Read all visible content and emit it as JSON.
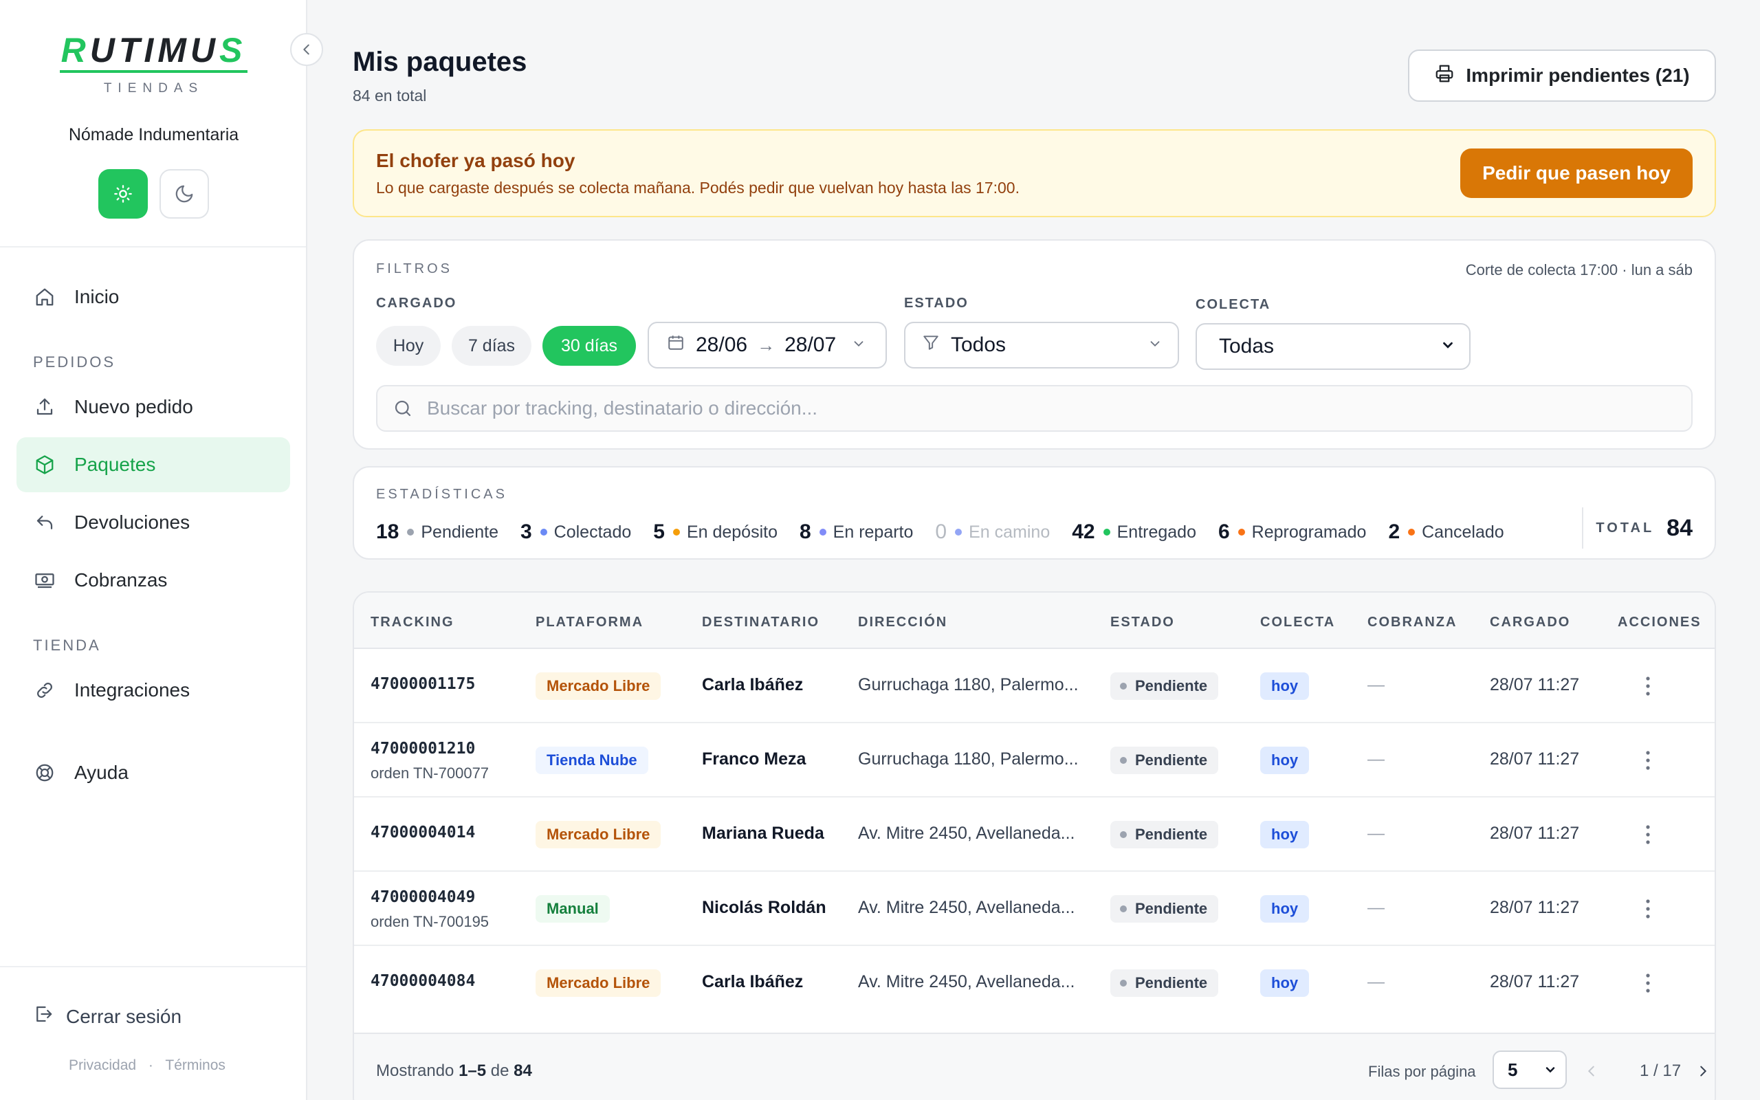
{
  "sidebar": {
    "logo_main_a": "R",
    "logo_main_b": "UTIMU",
    "logo_main_c": "S",
    "logo_sub": "TIENDAS",
    "store_name": "Nómade Indumentaria",
    "nav": {
      "inicio": "Inicio",
      "section_pedidos": "PEDIDOS",
      "nuevo_pedido": "Nuevo pedido",
      "paquetes": "Paquetes",
      "devoluciones": "Devoluciones",
      "cobranzas": "Cobranzas",
      "section_tienda": "TIENDA",
      "integraciones": "Integraciones",
      "ayuda": "Ayuda"
    },
    "logout": "Cerrar sesión",
    "privacy": "Privacidad",
    "legal_sep": "·",
    "terms": "Términos"
  },
  "header": {
    "title": "Mis paquetes",
    "subtitle": "84 en total",
    "print_label": "Imprimir pendientes (21)"
  },
  "banner": {
    "title": "El chofer ya pasó hoy",
    "text": "Lo que cargaste después se colecta mañana. Podés pedir que vuelvan hoy hasta las 17:00.",
    "button": "Pedir que pasen hoy"
  },
  "filters": {
    "heading": "FILTROS",
    "corte": "Corte de colecta 17:00 · lun a sáb",
    "cargado_label": "CARGADO",
    "chips": [
      "Hoy",
      "7 días",
      "30 días"
    ],
    "active_chip": "30 días",
    "date_from": "28/06",
    "date_arrow": "→",
    "date_to": "28/07",
    "estado_label": "ESTADO",
    "estado_value": "Todos",
    "colecta_label": "COLECTA",
    "colecta_value": "Todas",
    "search_placeholder": "Buscar por tracking, destinatario o dirección..."
  },
  "stats": {
    "heading": "ESTADÍSTICAS",
    "items": [
      {
        "num": "18",
        "label": "Pendiente",
        "color": "#9ca3af"
      },
      {
        "num": "3",
        "label": "Colectado",
        "color": "#6b8af5"
      },
      {
        "num": "5",
        "label": "En depósito",
        "color": "#f59e0b"
      },
      {
        "num": "8",
        "label": "En reparto",
        "color": "#818cf8"
      },
      {
        "num": "0",
        "label": "En camino",
        "color": "#93a5f5"
      },
      {
        "num": "42",
        "label": "Entregado",
        "color": "#22c55e"
      },
      {
        "num": "6",
        "label": "Reprogramado",
        "color": "#f97316"
      },
      {
        "num": "2",
        "label": "Cancelado",
        "color": "#f97316"
      }
    ],
    "total_label": "TOTAL",
    "total_value": "84"
  },
  "table": {
    "headers": [
      "TRACKING",
      "PLATAFORMA",
      "DESTINATARIO",
      "DIRECCIÓN",
      "ESTADO",
      "COLECTA",
      "COBRANZA",
      "CARGADO",
      "ACCIONES"
    ],
    "rows": [
      {
        "tracking": "47000001175",
        "order": "",
        "platform": "Mercado Libre",
        "recipient": "Carla Ibáñez",
        "address": "Gurruchaga 1180, Palermo...",
        "status": "Pendiente",
        "colecta": "hoy",
        "cobranza": "—",
        "cargado": "28/07 11:27"
      },
      {
        "tracking": "47000001210",
        "order": "orden TN-700077",
        "platform": "Tienda Nube",
        "recipient": "Franco Meza",
        "address": "Gurruchaga 1180, Palermo...",
        "status": "Pendiente",
        "colecta": "hoy",
        "cobranza": "—",
        "cargado": "28/07 11:27"
      },
      {
        "tracking": "47000004014",
        "order": "",
        "platform": "Mercado Libre",
        "recipient": "Mariana Rueda",
        "address": "Av. Mitre 2450, Avellaneda...",
        "status": "Pendiente",
        "colecta": "hoy",
        "cobranza": "—",
        "cargado": "28/07 11:27"
      },
      {
        "tracking": "47000004049",
        "order": "orden TN-700195",
        "platform": "Manual",
        "recipient": "Nicolás Roldán",
        "address": "Av. Mitre 2450, Avellaneda...",
        "status": "Pendiente",
        "colecta": "hoy",
        "cobranza": "—",
        "cargado": "28/07 11:27"
      },
      {
        "tracking": "47000004084",
        "order": "",
        "platform": "Mercado Libre",
        "recipient": "Carla Ibáñez",
        "address": "Av. Mitre 2450, Avellaneda...",
        "status": "Pendiente",
        "colecta": "hoy",
        "cobranza": "—",
        "cargado": "28/07 11:27"
      }
    ]
  },
  "footer": {
    "showing_prefix": "Mostrando",
    "showing_range": "1–5",
    "showing_of": "de",
    "showing_total": "84",
    "rows_per_page_label": "Filas por página",
    "rows_per_page": "5",
    "page_info": "1 / 17"
  },
  "colors": {
    "accent": "#22c55e",
    "warning": "#d97706"
  }
}
